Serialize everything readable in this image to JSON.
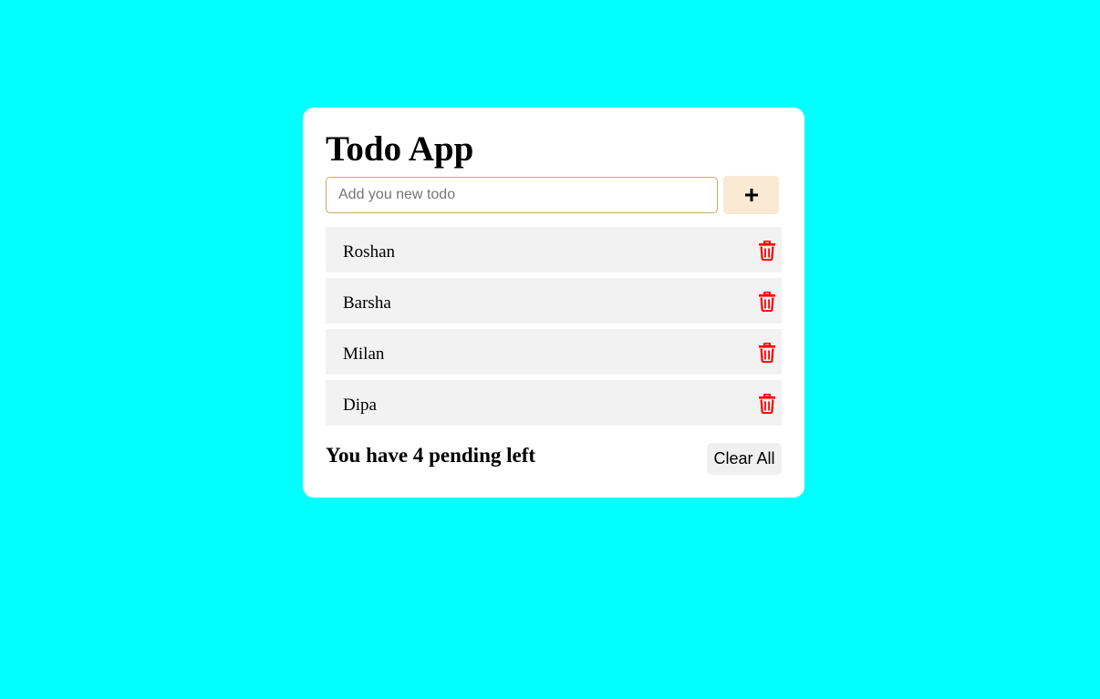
{
  "app": {
    "title": "Todo App"
  },
  "input": {
    "placeholder": "Add you new todo",
    "value": ""
  },
  "add_button": {
    "icon": "plus-icon"
  },
  "todos": [
    {
      "text": "Roshan",
      "delete_icon": "trash-icon"
    },
    {
      "text": "Barsha",
      "delete_icon": "trash-icon"
    },
    {
      "text": "Milan",
      "delete_icon": "trash-icon"
    },
    {
      "text": "Dipa",
      "delete_icon": "trash-icon"
    }
  ],
  "footer": {
    "pending_text": "You have 4 pending left",
    "clear_label": "Clear All"
  },
  "colors": {
    "background": "#00ffff",
    "card": "#ffffff",
    "add_button": "#fae9d3",
    "item_background": "#f2f2f2",
    "delete_icon": "#ff0000",
    "input_border": "#c9a86a"
  }
}
